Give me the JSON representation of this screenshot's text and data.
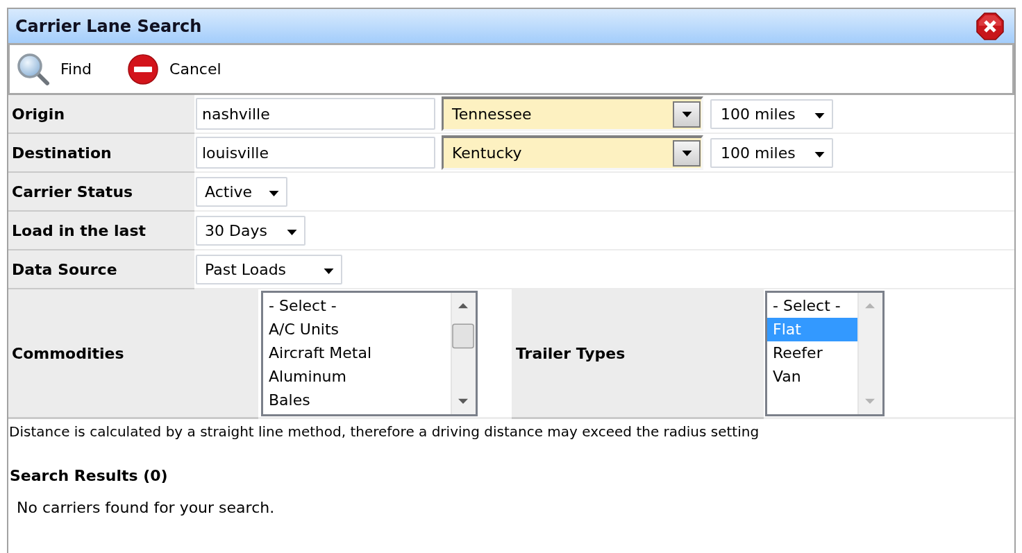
{
  "window": {
    "title": "Carrier Lane Search"
  },
  "toolbar": [
    {
      "kind": "find",
      "label": "Find"
    },
    {
      "kind": "cancel",
      "label": "Cancel"
    }
  ],
  "form": {
    "rows": [
      {
        "kind": "location",
        "label": "Origin",
        "city": "nashville",
        "state": "Tennessee",
        "highlighted": true,
        "radius": "100 miles"
      },
      {
        "kind": "location",
        "label": "Destination",
        "city": "louisville",
        "state": "Kentucky",
        "highlighted": true,
        "radius": "100 miles"
      },
      {
        "kind": "select",
        "label": "Carrier Status",
        "value": "Active"
      },
      {
        "kind": "select",
        "label": "Load in the last",
        "value": "30 Days"
      },
      {
        "kind": "select",
        "label": "Data Source",
        "value": "Past Loads"
      }
    ],
    "lists": [
      {
        "label": "Commodities",
        "scrollable": true,
        "options": [
          {
            "label": "- Select -",
            "selected": false
          },
          {
            "label": "A/C Units",
            "selected": false
          },
          {
            "label": "Aircraft Metal",
            "selected": false
          },
          {
            "label": "Aluminum",
            "selected": false
          },
          {
            "label": "Bales",
            "selected": false
          }
        ]
      },
      {
        "label": "Trailer Types",
        "scrollable": false,
        "options": [
          {
            "label": "- Select -",
            "selected": false
          },
          {
            "label": "Flat",
            "selected": true
          },
          {
            "label": "Reefer",
            "selected": false
          },
          {
            "label": "Van",
            "selected": false
          }
        ]
      }
    ]
  },
  "note": "Distance is calculated by a straight line method, therefore a driving distance may exceed the radius setting",
  "results": {
    "title": "Search Results (0)",
    "message": "No carriers found for your search."
  }
}
